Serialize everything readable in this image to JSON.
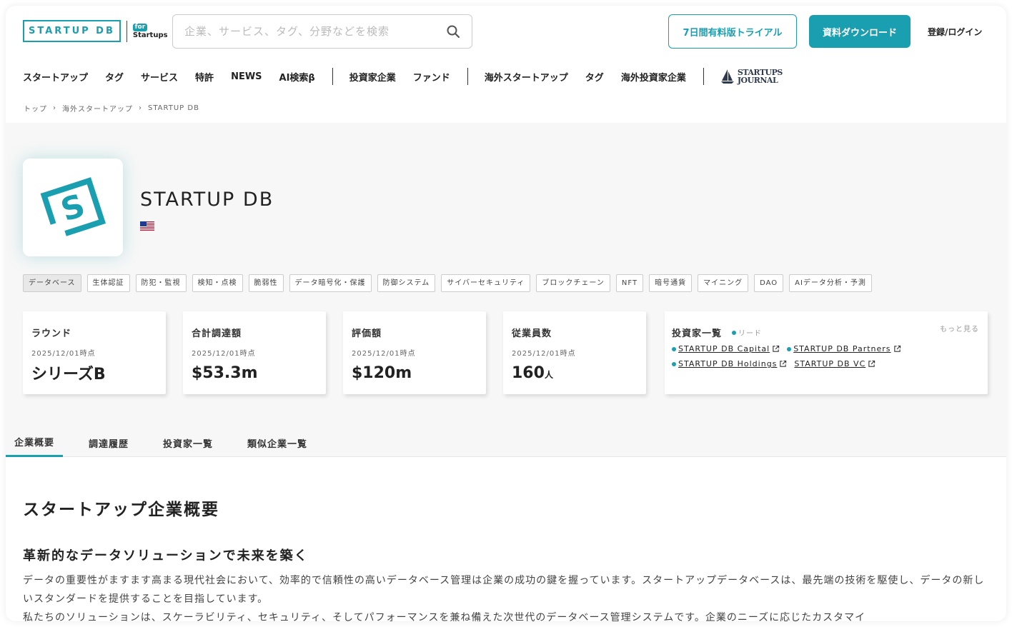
{
  "header": {
    "logo_text": "STARTUP DB",
    "logo_for": "for",
    "logo_startups": "Startups",
    "search_placeholder": "企業、サービス、タグ、分野などを検索",
    "trial_label": "7日間有料版トライアル",
    "download_label": "資料ダウンロード",
    "login_label": "登録/ログイン"
  },
  "nav": {
    "group1": [
      "スタートアップ",
      "タグ",
      "サービス",
      "特許",
      "NEWS",
      "AI検索β"
    ],
    "group2": [
      "投資家企業",
      "ファンド"
    ],
    "group3": [
      "海外スタートアップ",
      "タグ",
      "海外投資家企業"
    ],
    "journal_line1": "STARTUPS",
    "journal_line2": "JOURNAL"
  },
  "breadcrumb": [
    "トップ",
    "海外スタートアップ",
    "STARTUP DB"
  ],
  "company": {
    "name": "STARTUP DB",
    "tags": [
      "データベース",
      "生体認証",
      "防犯・監視",
      "検知・点検",
      "脆弱性",
      "データ暗号化・保護",
      "防御システム",
      "サイバーセキュリティ",
      "ブロックチェーン",
      "NFT",
      "暗号通貨",
      "マイニング",
      "DAO",
      "AIデータ分析・予測"
    ]
  },
  "stats": [
    {
      "title": "ラウンド",
      "date": "2025/12/01時点",
      "value": "シリーズB",
      "unit": ""
    },
    {
      "title": "合計調達額",
      "date": "2025/12/01時点",
      "value": "$53.3m",
      "unit": ""
    },
    {
      "title": "評価額",
      "date": "2025/12/01時点",
      "value": "$120m",
      "unit": ""
    },
    {
      "title": "従業員数",
      "date": "2025/12/01時点",
      "value": "160",
      "unit": "人"
    }
  ],
  "investors": {
    "title": "投資家一覧",
    "lead_label": "リード",
    "more_label": "もっと見る",
    "items": [
      {
        "name": "STARTUP DB Capital",
        "lead": true
      },
      {
        "name": "STARTUP DB Partners",
        "lead": true
      },
      {
        "name": "STARTUP DB Holdings",
        "lead": true
      },
      {
        "name": "STARTUP DB VC",
        "lead": false
      }
    ]
  },
  "tabs": [
    "企業概要",
    "調達履歴",
    "投資家一覧",
    "類似企業一覧"
  ],
  "content": {
    "heading": "スタートアップ企業概要",
    "subheading": "革新的なデータソリューションで未来を築く",
    "paragraph1": "データの重要性がますます高まる現代社会において、効率的で信頼性の高いデータベース管理は企業の成功の鍵を握っています。スタートアップデータベースは、最先端の技術を駆使し、データの新しいスタンダードを提供することを目指しています。",
    "paragraph2": "私たちのソリューションは、スケーラビリティ、セキュリティ、そしてパフォーマンスを兼ね備えた次世代のデータベース管理システムです。企業のニーズに応じたカスタマイ"
  },
  "colors": {
    "accent": "#1a9fb0"
  }
}
